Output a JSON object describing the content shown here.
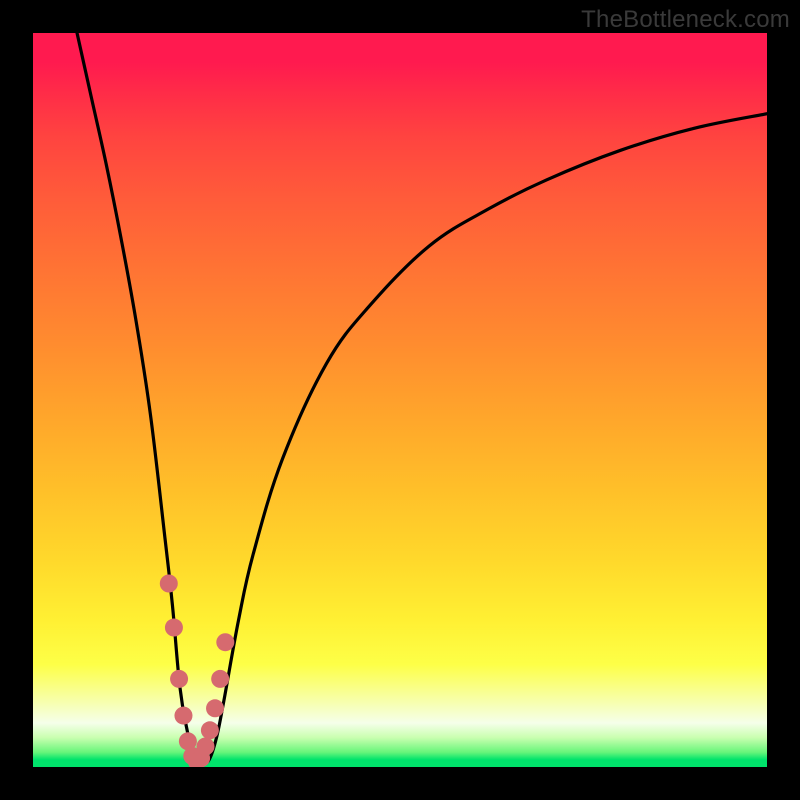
{
  "watermark": {
    "text": "TheBottleneck.com"
  },
  "chart_data": {
    "type": "line",
    "title": "",
    "xlabel": "",
    "ylabel": "",
    "xlim": [
      0,
      100
    ],
    "ylim": [
      0,
      100
    ],
    "grid": false,
    "legend": false,
    "series": [
      {
        "name": "curve",
        "x": [
          6,
          8,
          10,
          12,
          14,
          16,
          18,
          19,
          20,
          21,
          22,
          23,
          24,
          25,
          26,
          28,
          30,
          34,
          40,
          46,
          54,
          62,
          70,
          80,
          90,
          100
        ],
        "y": [
          100,
          91,
          82,
          72,
          61,
          48,
          31,
          22,
          11,
          5,
          1,
          0.5,
          1,
          4,
          9,
          20,
          29,
          42,
          55,
          63,
          71,
          76,
          80,
          84,
          87,
          89
        ]
      }
    ],
    "markers": {
      "name": "highlight",
      "color": "#d66a6f",
      "x": [
        18.5,
        19.2,
        19.9,
        20.5,
        21.1,
        21.7,
        22.3,
        22.9,
        23.5,
        24.1,
        24.8,
        25.5,
        26.2
      ],
      "y": [
        25,
        19,
        12,
        7,
        3.5,
        1.5,
        0.8,
        1.2,
        2.8,
        5,
        8,
        12,
        17
      ]
    },
    "gradient": {
      "stops": [
        {
          "offset": 0,
          "color": "#ff1a4f"
        },
        {
          "offset": 4,
          "color": "#ff1a4f"
        },
        {
          "offset": 8,
          "color": "#ff2b48"
        },
        {
          "offset": 14,
          "color": "#ff4340"
        },
        {
          "offset": 22,
          "color": "#ff5a3a"
        },
        {
          "offset": 32,
          "color": "#ff7334"
        },
        {
          "offset": 42,
          "color": "#ff8b2f"
        },
        {
          "offset": 52,
          "color": "#ffa52b"
        },
        {
          "offset": 62,
          "color": "#ffbf29"
        },
        {
          "offset": 72,
          "color": "#ffd92b"
        },
        {
          "offset": 80,
          "color": "#fff033"
        },
        {
          "offset": 86,
          "color": "#fdff47"
        },
        {
          "offset": 91,
          "color": "#f7ffab"
        },
        {
          "offset": 94,
          "color": "#f5ffea"
        },
        {
          "offset": 96,
          "color": "#c9ffb0"
        },
        {
          "offset": 98,
          "color": "#67f57a"
        },
        {
          "offset": 99,
          "color": "#00e36b"
        },
        {
          "offset": 100,
          "color": "#00e36b"
        }
      ]
    }
  }
}
